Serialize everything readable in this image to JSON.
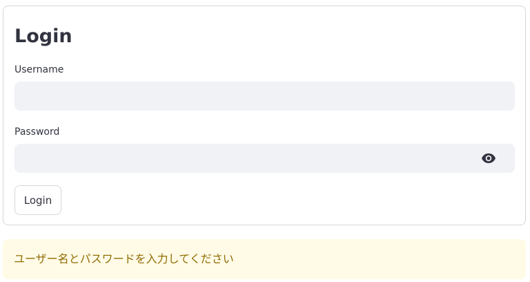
{
  "login_form": {
    "title": "Login",
    "username_label": "Username",
    "username_value": "",
    "password_label": "Password",
    "password_value": "",
    "show_password_icon": "eye-icon",
    "submit_label": "Login"
  },
  "alert": {
    "type": "warning",
    "message": "ユーザー名とパスワードを入力してください"
  },
  "colors": {
    "input_background": "#f0f2f6",
    "border": "#d6d6d9",
    "text": "#31333f",
    "warning_background": "#fffbe6",
    "warning_text": "#926c05"
  }
}
